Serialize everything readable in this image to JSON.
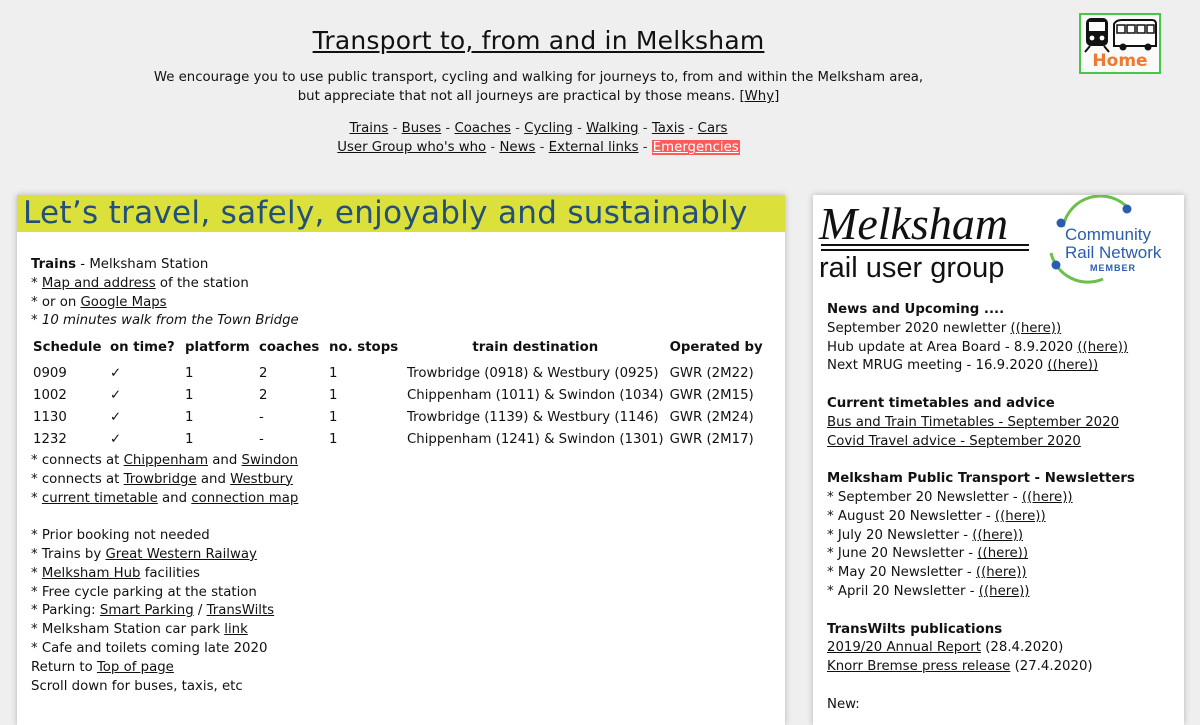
{
  "header": {
    "title": "Transport to, from and in Melksham",
    "intro_line1": "We encourage you to use public transport, cycling and walking for journeys to, from and within the Melksham area,",
    "intro_line2": "but appreciate that not all journeys are practical by those means.",
    "why_link": "[Why]",
    "home_label": "Home"
  },
  "nav": {
    "row1": [
      "Trains",
      "Buses",
      "Coaches",
      "Cycling",
      "Walking",
      "Taxis",
      "Cars"
    ],
    "row2": [
      "User Group who's who",
      "News",
      "External links"
    ],
    "emergencies": "Emergencies",
    "separator": " - "
  },
  "left": {
    "banner": "Let’s travel, safely, enjoyably and sustainably",
    "trains_heading": "Trains",
    "trains_sub": " - Melksham Station",
    "map_link": "Map and address",
    "map_suffix": " of the station",
    "google_prefix": "* or on ",
    "google_link": "Google Maps",
    "walk_note": "10 minutes walk from the Town Bridge",
    "table": {
      "headers": [
        "Schedule",
        "on time?",
        "platform",
        "coaches",
        "no. stops",
        "train destination",
        "Operated by"
      ],
      "rows": [
        [
          "0909",
          "✓",
          "1",
          "2",
          "1",
          "Trowbridge (0918) & Westbury (0925)",
          "GWR (2M22)"
        ],
        [
          "1002",
          "✓",
          "1",
          "2",
          "1",
          "Chippenham (1011) & Swindon (1034)",
          "GWR (2M15)"
        ],
        [
          "1130",
          "✓",
          "1",
          "-",
          "1",
          "Trowbridge (1139) & Westbury (1146)",
          "GWR (2M24)"
        ],
        [
          "1232",
          "✓",
          "1",
          "-",
          "1",
          "Chippenham (1241) & Swindon (1301)",
          "GWR (2M17)"
        ]
      ]
    },
    "connects1": {
      "prefix": "* connects at ",
      "a": "Chippenham",
      "mid": " and ",
      "b": "Swindon"
    },
    "connects2": {
      "prefix": "* connects at ",
      "a": "Trowbridge",
      "mid": " and ",
      "b": "Westbury"
    },
    "timetable": {
      "prefix": "* ",
      "a": "current timetable",
      "mid": " and ",
      "b": "connection map"
    },
    "prior_booking": "* Prior booking not needed",
    "trains_by": {
      "prefix": "* Trains by ",
      "link": "Great Western Railway"
    },
    "hub": {
      "prefix": "* ",
      "link": "Melksham Hub",
      "suffix": " facilities"
    },
    "cycle_parking": "* Free cycle parking at the station",
    "parking": {
      "prefix": "* Parking: ",
      "a": "Smart Parking",
      "mid": " / ",
      "b": "TransWilts"
    },
    "car_park": {
      "prefix": "* Melksham Station car park ",
      "link": "link"
    },
    "cafe": "* Cafe and toilets coming late 2020",
    "return": {
      "prefix": "Return to ",
      "link": "Top of page"
    },
    "scroll": "Scroll down for buses, taxis, etc"
  },
  "right": {
    "logo_main": "Melksham",
    "logo_sub": "rail user group",
    "crn_line1": "Community",
    "crn_line2": "Rail Network",
    "crn_member": "MEMBER",
    "news_heading": "News and Upcoming ....",
    "news": [
      {
        "text": "September 2020 newletter ",
        "link": "((here))"
      },
      {
        "text": "Hub update at Area Board - 8.9.2020 ",
        "link": "((here))"
      },
      {
        "text": "Next MRUG meeting - 16.9.2020 ",
        "link": "((here))"
      }
    ],
    "timetables_heading": "Current timetables and advice",
    "timetables": [
      "Bus and Train Timetables - September 2020",
      "Covid Travel advice - September 2020"
    ],
    "newsletters_heading": "Melksham Public Transport - Newsletters",
    "newsletters": [
      {
        "text": "* September 20 Newsletter - ",
        "link": "((here))"
      },
      {
        "text": "* August 20 Newsletter - ",
        "link": "((here))"
      },
      {
        "text": "* July 20 Newsletter - ",
        "link": "((here))"
      },
      {
        "text": "* June 20 Newsletter - ",
        "link": "((here))"
      },
      {
        "text": "* May 20 Newsletter - ",
        "link": "((here))"
      },
      {
        "text": "* April 20 Newsletter - ",
        "link": "((here))"
      }
    ],
    "transwilts_heading": "TransWilts publications",
    "transwilts": [
      {
        "link": "2019/20 Annual Report",
        "text": " (28.4.2020)"
      },
      {
        "link": "Knorr Bremse press release",
        "text": " (27.4.2020)"
      }
    ],
    "cutoff_text": "New:"
  },
  "colors": {
    "banner_bg": "#dce03a",
    "banner_text": "#22507a",
    "emergency_bg": "#ff5a5a",
    "home_border": "#46c846",
    "home_text": "#f07830",
    "crn_blue": "#2a5db0",
    "crn_green": "#6cc04a"
  },
  "icons": [
    "train-icon",
    "bus-icon",
    "crn-logo-icon"
  ]
}
